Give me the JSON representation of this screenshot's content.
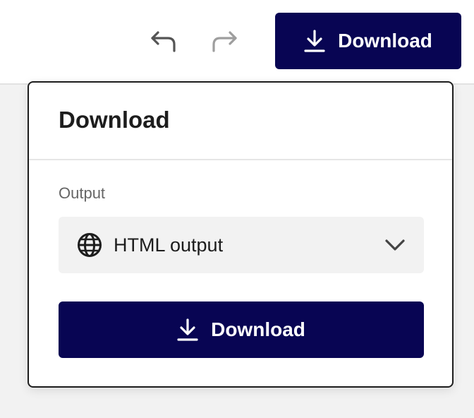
{
  "toolbar": {
    "undo_icon": "undo-arrow-icon",
    "redo_icon": "redo-arrow-icon",
    "download_label": "Download"
  },
  "popover": {
    "title": "Download",
    "output_label": "Output",
    "output_select": {
      "icon": "globe-icon",
      "value": "HTML output"
    },
    "download_label": "Download"
  },
  "colors": {
    "primary": "#080553",
    "background": "#f2f2f2",
    "select_bg": "#f2f2f2",
    "text": "#1d1d1d",
    "muted_text": "#666666",
    "redo_disabled": "#9e9e9e"
  }
}
